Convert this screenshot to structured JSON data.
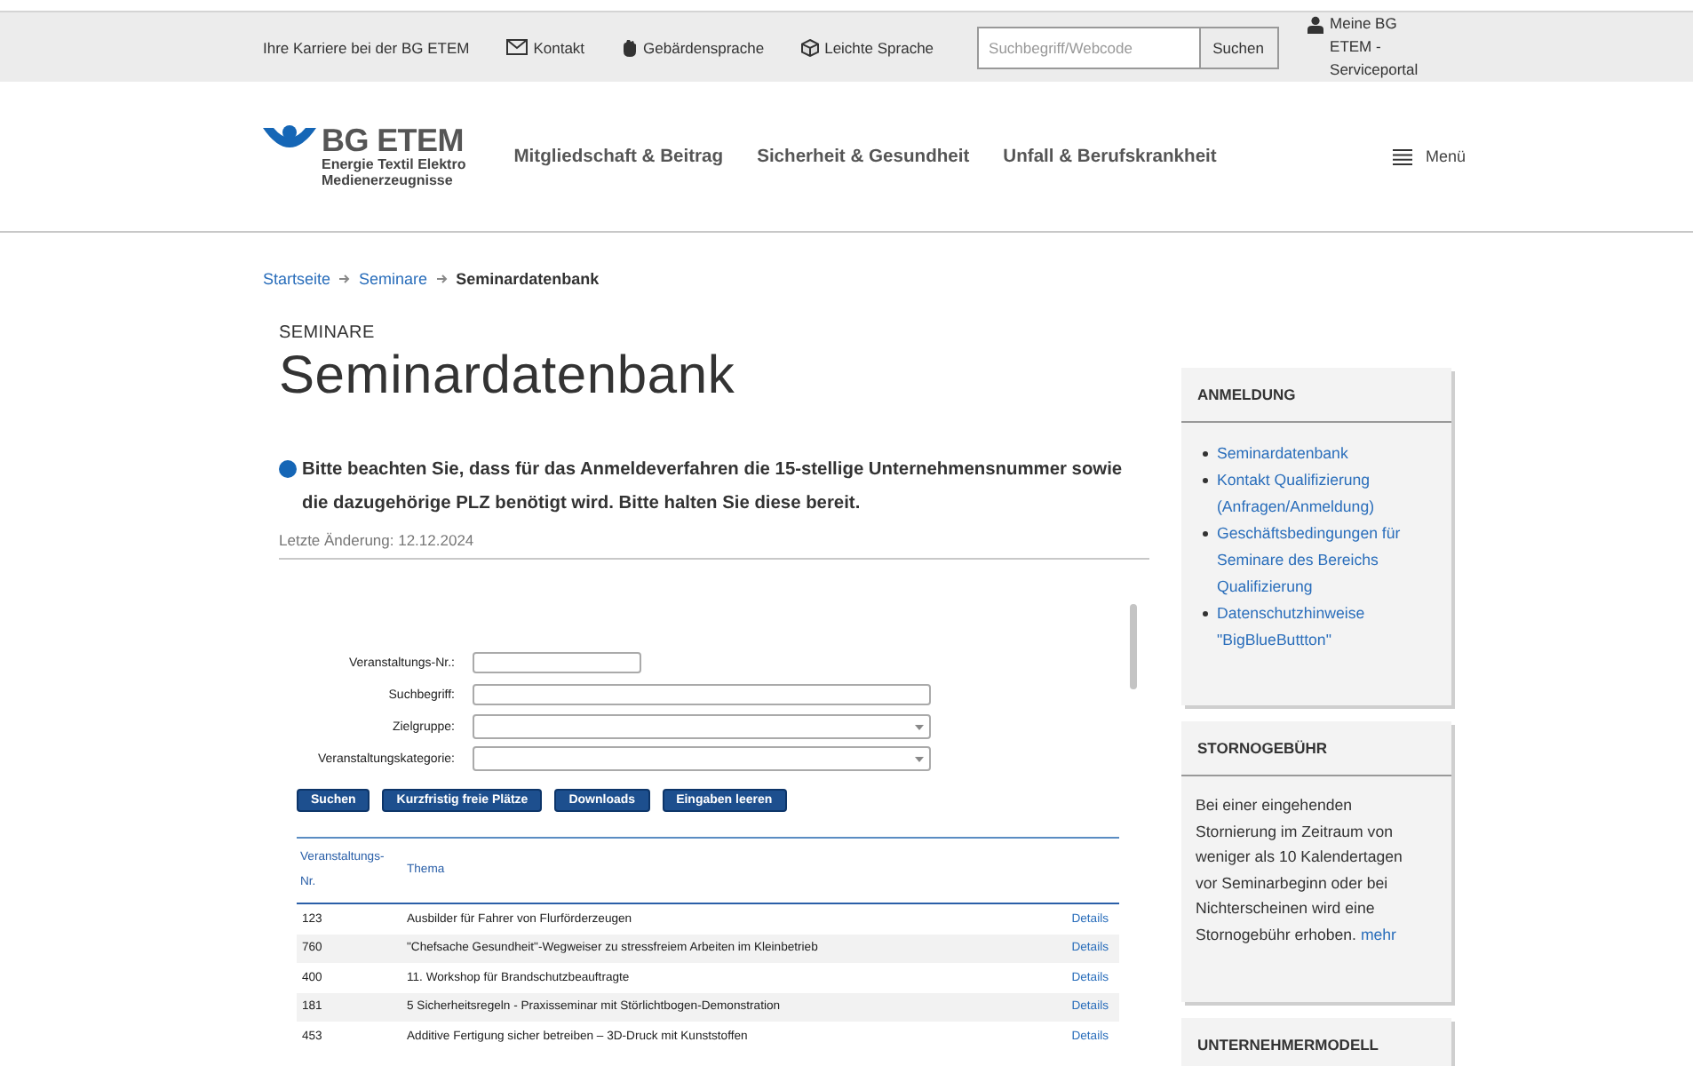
{
  "top_bar": {
    "links": [
      {
        "label": "Ihre Karriere bei der BG ETEM",
        "kind": "plain"
      },
      {
        "label": "Kontakt",
        "kind": "mail"
      },
      {
        "label": "Gebärdensprache",
        "kind": "hand"
      },
      {
        "label": "Leichte Sprache",
        "kind": "cube"
      }
    ],
    "search": {
      "placeholder": "Suchbegriff/Webcode",
      "button": "Suchen"
    },
    "account": "Meine BG ETEM - Serviceportal"
  },
  "logo": {
    "name": "BG ETEM",
    "tagline": [
      "Energie Textil Elektro",
      "Medienerzeugnisse"
    ]
  },
  "main_nav": {
    "items": [
      "Mitgliedschaft & Beitrag",
      "Sicherheit & Gesundheit",
      "Unfall & Berufskrankheit"
    ],
    "menu": "Menü"
  },
  "breadcrumb": [
    {
      "label": "Startseite",
      "current": false
    },
    {
      "label": "Seminare",
      "current": false
    },
    {
      "label": "Seminardatenbank",
      "current": true
    }
  ],
  "page": {
    "kicker": "SEMINARE",
    "title": "Seminardatenbank",
    "notice": "Bitte beachten Sie, dass für das Anmeldeverfahren die 15-stellige Unternehmensnummer sowie die dazugehörige PLZ benötigt wird. Bitte halten Sie diese bereit.",
    "last_changed": "Letzte Änderung: 12.12.2024"
  },
  "form": {
    "fields": [
      {
        "label": "Veranstaltungs-Nr.:",
        "kind": "short"
      },
      {
        "label": "Suchbegriff:",
        "kind": "text"
      },
      {
        "label": "Zielgruppe:",
        "kind": "select"
      },
      {
        "label": "Veranstaltungskategorie:",
        "kind": "select"
      }
    ],
    "buttons": [
      "Suchen",
      "Kurzfristig freie Plätze",
      "Downloads",
      "Eingaben leeren"
    ]
  },
  "table": {
    "columns": [
      "Veranstaltungs-Nr.",
      "Thema"
    ],
    "rows": [
      {
        "nr": "123",
        "topic": "Ausbilder für Fahrer von Flurförderzeugen",
        "link": "Details"
      },
      {
        "nr": "760",
        "topic": "\"Chefsache Gesundheit\"-Wegweiser zu stressfreiem Arbeiten im Kleinbetrieb",
        "link": "Details"
      },
      {
        "nr": "400",
        "topic": "11. Workshop für Brandschutzbeauftragte",
        "link": "Details"
      },
      {
        "nr": "181",
        "topic": "5 Sicherheitsregeln - Praxisseminar mit Störlichtbogen-Demonstration",
        "link": "Details"
      },
      {
        "nr": "453",
        "topic": "Additive Fertigung sicher betreiben – 3D-Druck mit Kunststoffen",
        "link": "Details"
      }
    ]
  },
  "sidebar": [
    {
      "title": "ANMELDUNG",
      "kind": "links",
      "links": [
        "Seminardatenbank",
        "Kontakt Qualifizierung (Anfragen/Anmeldung)",
        "Geschäftsbedingungen für Seminare des Bereichs Qualifizierung",
        "Datenschutzhinweise \"BigBlueButtton\""
      ]
    },
    {
      "title": "STORNOGEBÜHR",
      "kind": "text",
      "text": "Bei einer eingehenden Stornierung im Zeitraum von weniger als 10 Kalendertagen vor Seminarbeginn oder bei Nichterscheinen wird eine Stornogebühr erhoben.",
      "link": "mehr"
    },
    {
      "title": "UNTERNEHMERMODELL",
      "kind": "empty"
    }
  ]
}
